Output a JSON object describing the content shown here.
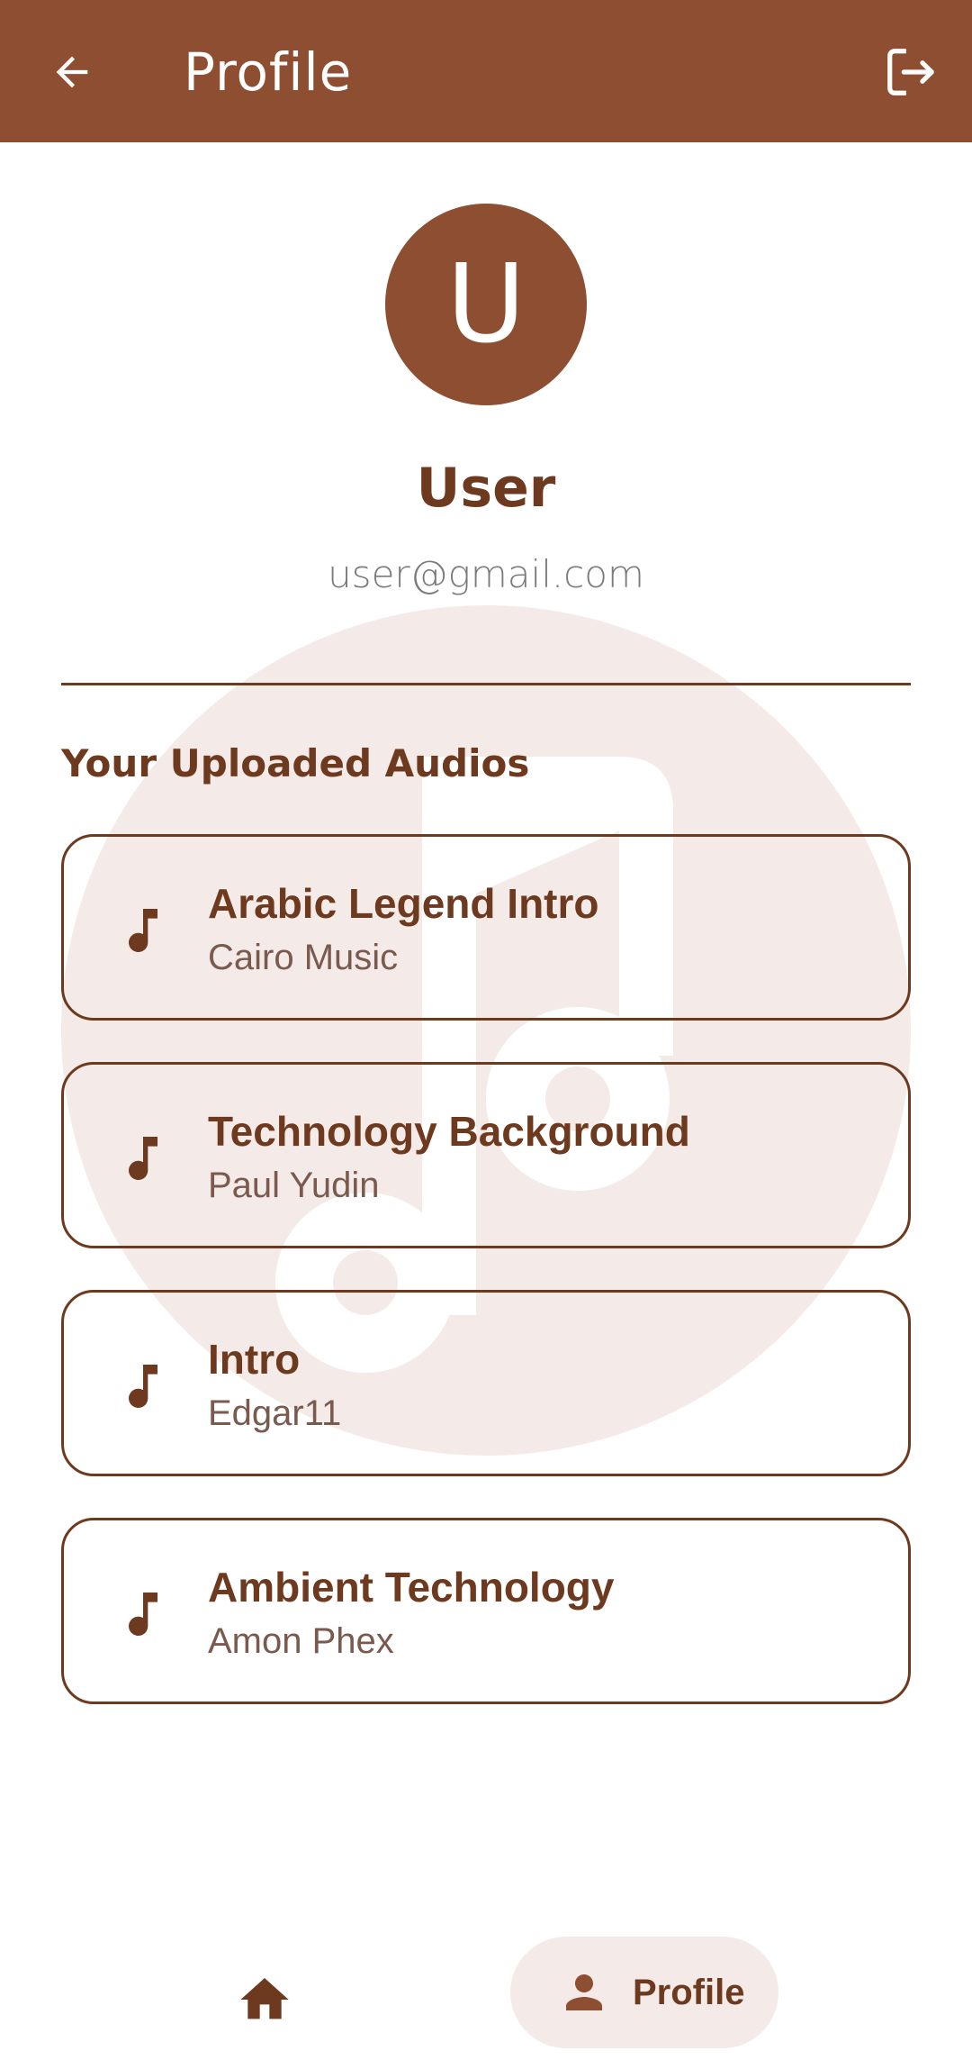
{
  "appbar": {
    "title": "Profile",
    "back_icon": "arrow-back-icon",
    "logout_icon": "logout-icon"
  },
  "profile": {
    "avatar_letter": "U",
    "name": "User",
    "email": "user@gmail.com"
  },
  "uploads": {
    "section_title": "Your Uploaded Audios",
    "items": [
      {
        "title": "Arabic Legend Intro",
        "artist": "Cairo Music",
        "icon": "music-note-icon"
      },
      {
        "title": "Technology Background",
        "artist": "Paul Yudin",
        "icon": "music-note-icon"
      },
      {
        "title": "Intro",
        "artist": "Edgar11",
        "icon": "music-note-icon"
      },
      {
        "title": "Ambient Technology",
        "artist": "Amon Phex",
        "icon": "music-note-icon"
      }
    ]
  },
  "bottom_nav": {
    "home_icon": "home-icon",
    "profile_icon": "person-icon",
    "profile_label": "Profile",
    "active": "Profile"
  },
  "colors": {
    "primary": "#8e4e31",
    "text_dark": "#6e3a1f",
    "email_gray": "#7b7b7b",
    "watermark": "#f4ebe8",
    "nav_pill": "#f4ebe8"
  }
}
